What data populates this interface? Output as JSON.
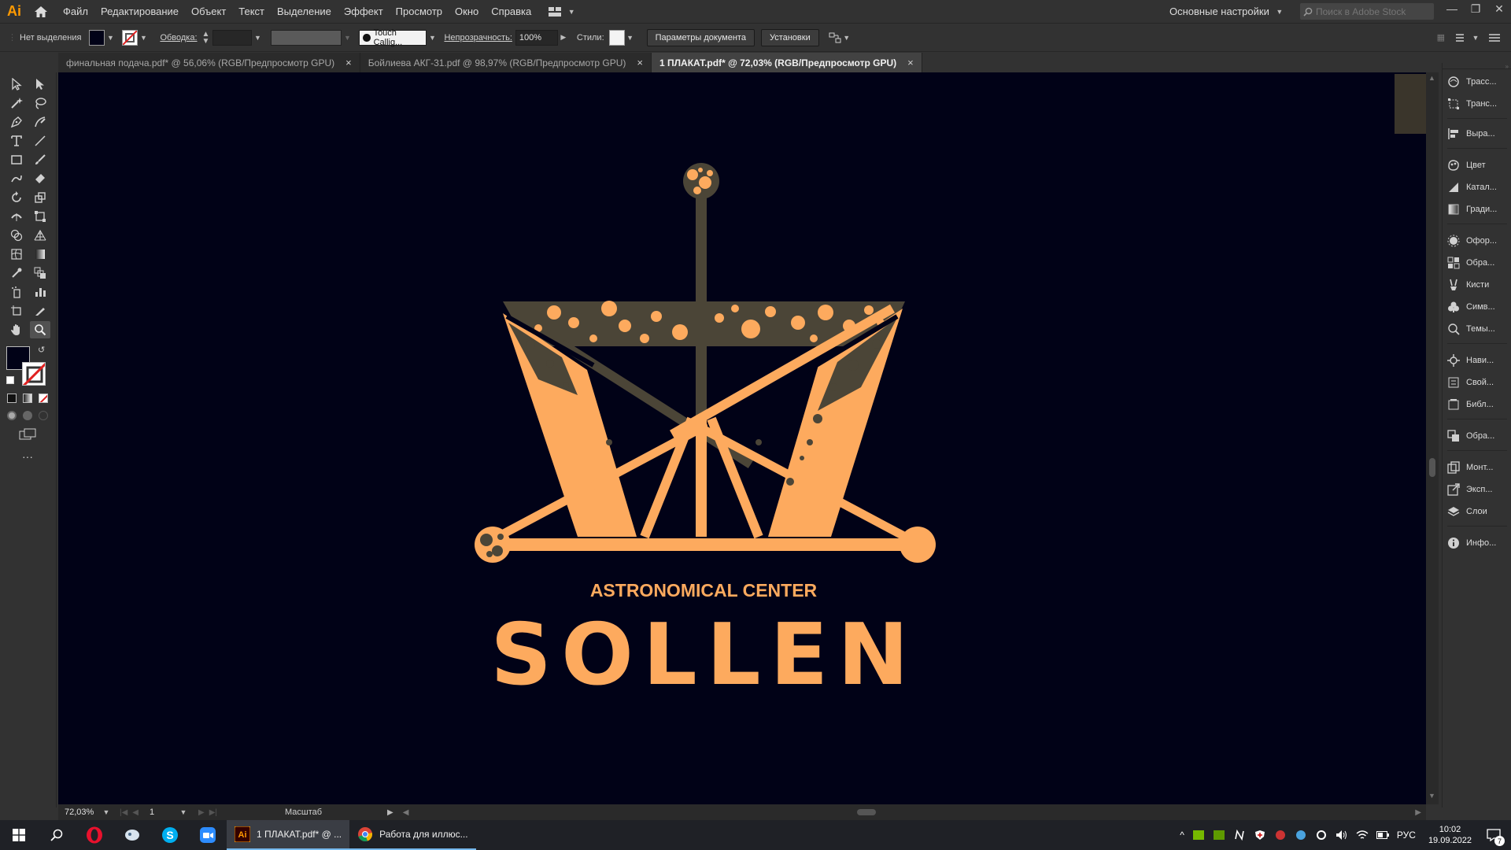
{
  "app": {
    "logo": "Ai",
    "menu": [
      "Файл",
      "Редактирование",
      "Объект",
      "Текст",
      "Выделение",
      "Эффект",
      "Просмотр",
      "Окно",
      "Справка"
    ],
    "workspace": "Основные настройки",
    "stock_placeholder": "Поиск в Adobe Stock"
  },
  "control": {
    "selection": "Нет выделения",
    "stroke_label": "Обводка:",
    "brush": "Touch Callig...",
    "opacity_label": "Непрозрачность:",
    "opacity": "100%",
    "styles_label": "Стили:",
    "doc_params": "Параметры документа",
    "prefs": "Установки"
  },
  "tabs": [
    {
      "label": "финальная подача.pdf* @ 56,06% (RGB/Предпросмотр GPU)"
    },
    {
      "label": "Бойлиева АКГ-31.pdf @ 98,97% (RGB/Предпросмотр GPU)"
    },
    {
      "label": "1 ПЛАКАТ.pdf* @ 72,03% (RGB/Предпросмотр GPU)"
    }
  ],
  "artwork": {
    "subtitle": "ASTRONOMICAL CENTER",
    "title": "SOLLEN",
    "colors": {
      "background": "#010217",
      "orange": "#FDAA5E",
      "brown": "#4B4537"
    }
  },
  "panels": [
    {
      "label": "Трасс...",
      "icon": "trace-icon"
    },
    {
      "label": "Транс...",
      "icon": "transform-icon"
    },
    {
      "label": "Выра...",
      "icon": "align-icon"
    },
    {
      "label": "Цвет",
      "icon": "color-icon"
    },
    {
      "label": "Катал...",
      "icon": "color-guide-icon"
    },
    {
      "label": "Гради...",
      "icon": "gradient-icon"
    },
    {
      "label": "Офор...",
      "icon": "appearance-icon"
    },
    {
      "label": "Обра...",
      "icon": "swatches-icon"
    },
    {
      "label": "Кисти",
      "icon": "brushes-icon"
    },
    {
      "label": "Симв...",
      "icon": "symbols-icon"
    },
    {
      "label": "Темы...",
      "icon": "themes-icon"
    },
    {
      "label": "Нави...",
      "icon": "navigator-icon"
    },
    {
      "label": "Свой...",
      "icon": "properties-icon"
    },
    {
      "label": "Библ...",
      "icon": "libraries-icon"
    },
    {
      "label": "Обра...",
      "icon": "pathfinder-icon"
    },
    {
      "label": "Монт...",
      "icon": "artboards-icon"
    },
    {
      "label": "Эксп...",
      "icon": "export-icon"
    },
    {
      "label": "Слои",
      "icon": "layers-icon"
    },
    {
      "label": "Инфо...",
      "icon": "info-icon"
    }
  ],
  "status": {
    "zoom": "72,03%",
    "artboard": "1",
    "info": "Масштаб"
  },
  "taskbar": {
    "apps": [
      {
        "label": "1 ПЛАКАТ.pdf* @ ..."
      },
      {
        "label": "Работа для иллюс..."
      }
    ],
    "lang": "РУС",
    "time": "10:02",
    "date": "19.09.2022",
    "notifications": "7"
  }
}
